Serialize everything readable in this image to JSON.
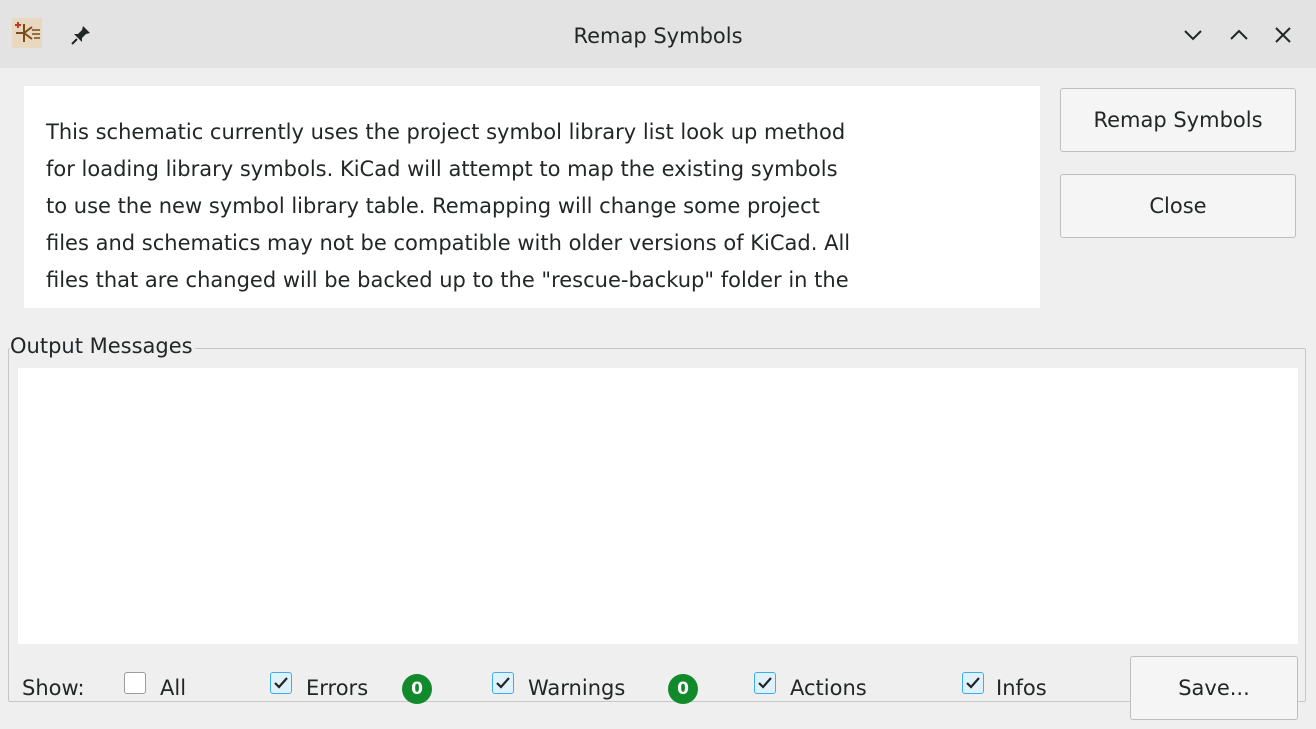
{
  "window": {
    "title": "Remap Symbols"
  },
  "description": {
    "lines": [
      "This schematic currently uses the project symbol library list look up method",
      "for loading library symbols. KiCad will attempt to map the existing symbols",
      "to use the new symbol library table. Remapping will change some project",
      "files and schematics may not be compatible with older versions of KiCad. All",
      "files that are changed will be backed up to the \"rescue-backup\" folder in the"
    ]
  },
  "buttons": {
    "remap_label": "Remap Symbols",
    "close_label": "Close",
    "save_label": "Save..."
  },
  "output": {
    "group_label": "Output Messages",
    "show_label": "Show:",
    "filters": [
      {
        "label": "All",
        "checked": false
      },
      {
        "label": "Errors",
        "checked": true,
        "count": "0"
      },
      {
        "label": "Warnings",
        "checked": true,
        "count": "0"
      },
      {
        "label": "Actions",
        "checked": true
      },
      {
        "label": "Infos",
        "checked": true
      }
    ]
  },
  "colors": {
    "accent": "#3daee9",
    "badge": "#118a2b"
  }
}
